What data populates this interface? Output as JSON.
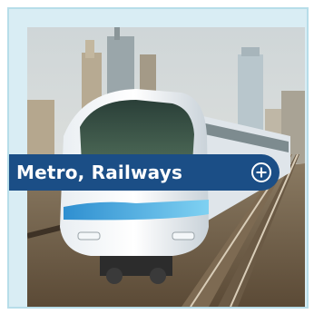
{
  "tile": {
    "label": "Metro, Railways",
    "expand_icon": "plus-circle-icon",
    "image_subject": "metro-train-photo"
  },
  "colors": {
    "label_background": "#1b4e86",
    "label_text": "#ffffff",
    "card_background": "#d9edf4",
    "card_border": "#b7dde9"
  }
}
